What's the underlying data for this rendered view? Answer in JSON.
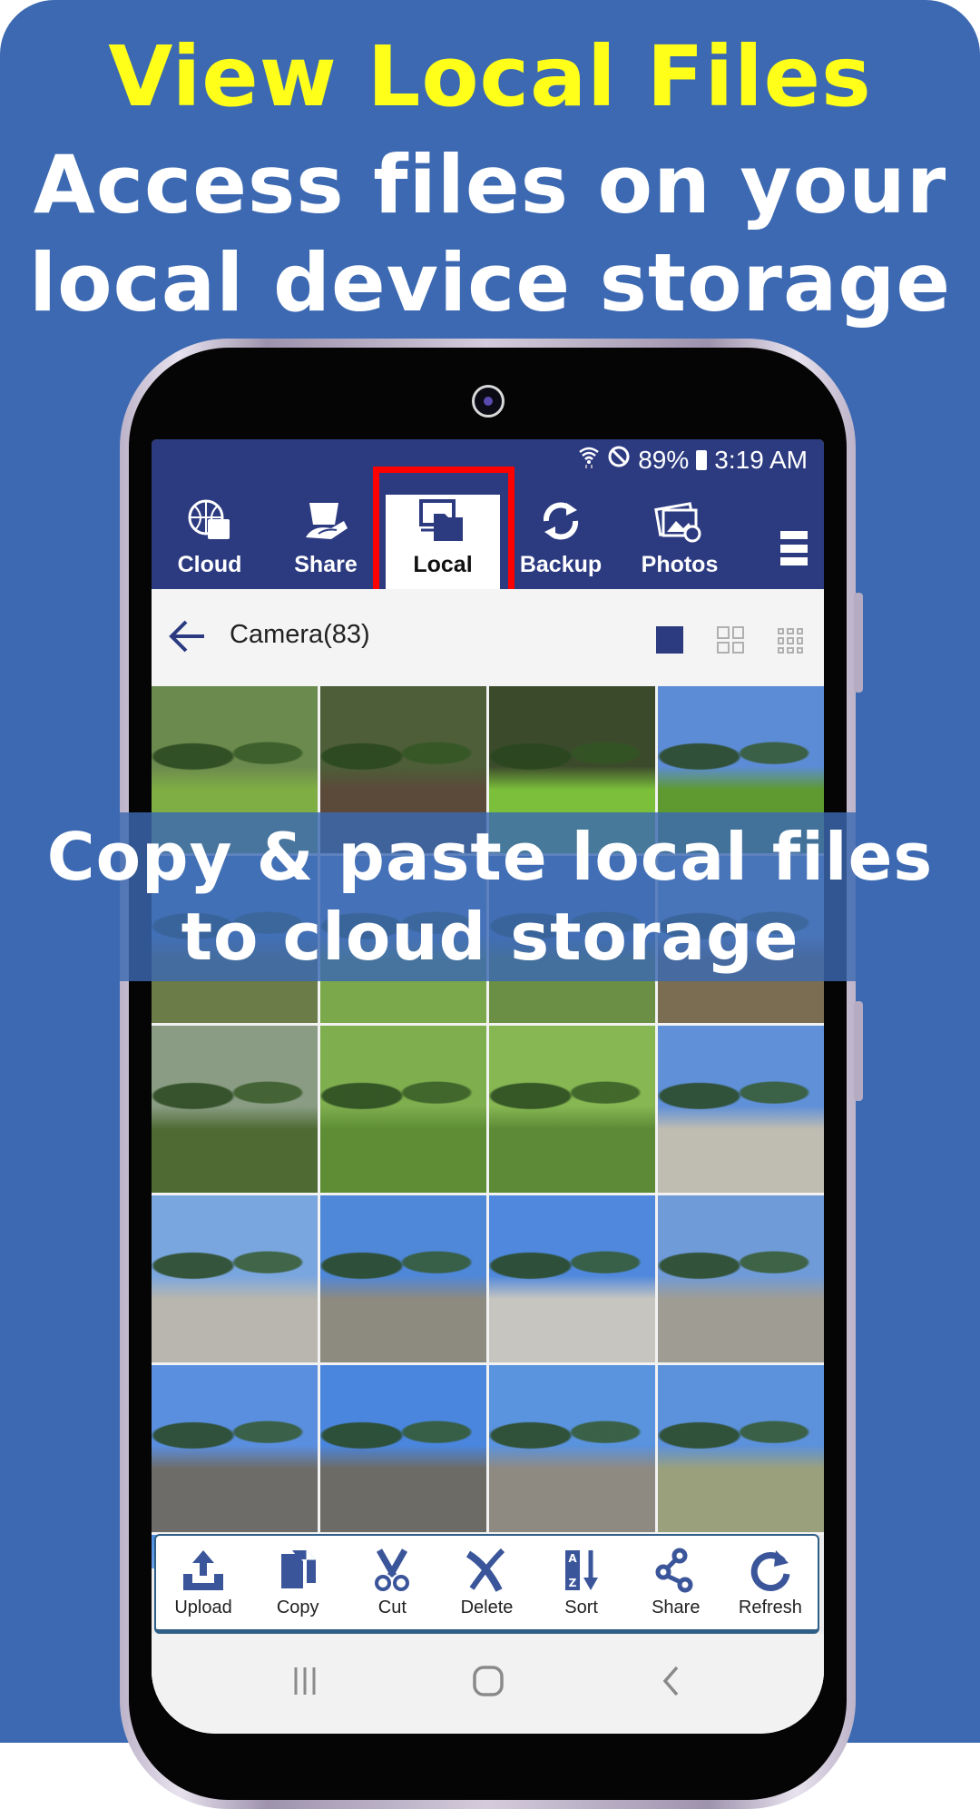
{
  "promo": {
    "headline": "View Local Files",
    "subline_1": "Access files on your",
    "subline_2": "local device storage",
    "overlay_line_1": "Copy & paste local files",
    "overlay_line_2": "to cloud storage"
  },
  "status_bar": {
    "battery": "89%",
    "time": "3:19 AM",
    "icons": [
      "wifi-icon",
      "do-not-disturb-icon",
      "battery-icon"
    ]
  },
  "tabs": [
    {
      "label": "Cloud",
      "icon": "cloud-globe-icon",
      "active": false
    },
    {
      "label": "Share",
      "icon": "share-hand-icon",
      "active": false
    },
    {
      "label": "Local",
      "icon": "local-device-icon",
      "active": true
    },
    {
      "label": "Backup",
      "icon": "sync-icon",
      "active": false
    },
    {
      "label": "Photos",
      "icon": "photos-sync-icon",
      "active": false
    }
  ],
  "header": {
    "title": "Camera(83)",
    "view_modes": [
      "single",
      "grid-2x2",
      "grid-3x3"
    ],
    "selected_view": "single"
  },
  "grid": {
    "columns": 4,
    "thumbnails": [
      {
        "scene": "flags-plaza",
        "sky": "#6b8a4e",
        "ground": "#7fae44"
      },
      {
        "scene": "tree-grove",
        "sky": "#4d5e38",
        "ground": "#5b4a39"
      },
      {
        "scene": "grass-slope",
        "sky": "#3c4a2c",
        "ground": "#7bbf3b"
      },
      {
        "scene": "park-lawn",
        "sky": "#5d8cd6",
        "ground": "#5e9a2f"
      },
      {
        "scene": "park-blue-sky",
        "sky": "#5f8fd0",
        "ground": "#6b7c49"
      },
      {
        "scene": "park-slope",
        "sky": "#6f98d6",
        "ground": "#7aa84a"
      },
      {
        "scene": "flags-field",
        "sky": "#5a86c8",
        "ground": "#6b8f44"
      },
      {
        "scene": "tall-pole",
        "sky": "#80a7de",
        "ground": "#7a6d52"
      },
      {
        "scene": "trees-sun",
        "sky": "#8a9d84",
        "ground": "#4f6b33"
      },
      {
        "scene": "green-trees",
        "sky": "#7fae4f",
        "ground": "#5e8d35"
      },
      {
        "scene": "tree-lawn",
        "sky": "#86b753",
        "ground": "#5d8a36"
      },
      {
        "scene": "white-gate",
        "sky": "#5f90d8",
        "ground": "#bfbcb2"
      },
      {
        "scene": "playground",
        "sky": "#7aa6e0",
        "ground": "#b8b6ae"
      },
      {
        "scene": "sunny-plaza",
        "sky": "#4f87d9",
        "ground": "#8d8a80"
      },
      {
        "scene": "paved-path",
        "sky": "#4f88dc",
        "ground": "#c7c5bf"
      },
      {
        "scene": "fountain-sun",
        "sky": "#6f9bd8",
        "ground": "#9f9c94"
      },
      {
        "scene": "flagpoles",
        "sky": "#5a8fe0",
        "ground": "#6e6c68"
      },
      {
        "scene": "sun-walkway",
        "sky": "#4a86de",
        "ground": "#6d6b66"
      },
      {
        "scene": "building-plaza",
        "sky": "#5a93de",
        "ground": "#8f8a81"
      },
      {
        "scene": "gazebo",
        "sky": "#5c91db",
        "ground": "#9aa07c"
      },
      {
        "scene": "sky-partial",
        "sky": "#4e8fe0",
        "ground": "#4e8fe0"
      },
      {
        "scene": "empty",
        "sky": "#ececec",
        "ground": "#ececec"
      },
      {
        "scene": "empty",
        "sky": "#ececec",
        "ground": "#ececec"
      },
      {
        "scene": "empty",
        "sky": "#ececec",
        "ground": "#ececec"
      }
    ]
  },
  "toolbar": [
    {
      "label": "Upload",
      "icon": "upload-icon"
    },
    {
      "label": "Copy",
      "icon": "copy-icon"
    },
    {
      "label": "Cut",
      "icon": "cut-icon"
    },
    {
      "label": "Delete",
      "icon": "delete-icon"
    },
    {
      "label": "Sort",
      "icon": "sort-az-icon"
    },
    {
      "label": "Share",
      "icon": "share-icon"
    },
    {
      "label": "Refresh",
      "icon": "refresh-icon"
    }
  ],
  "colors": {
    "background": "#3c69b1",
    "headline": "#ffff1a",
    "app_bar": "#2c3a80",
    "icon_blue": "#3a5599",
    "highlight_box": "#ff0000"
  }
}
